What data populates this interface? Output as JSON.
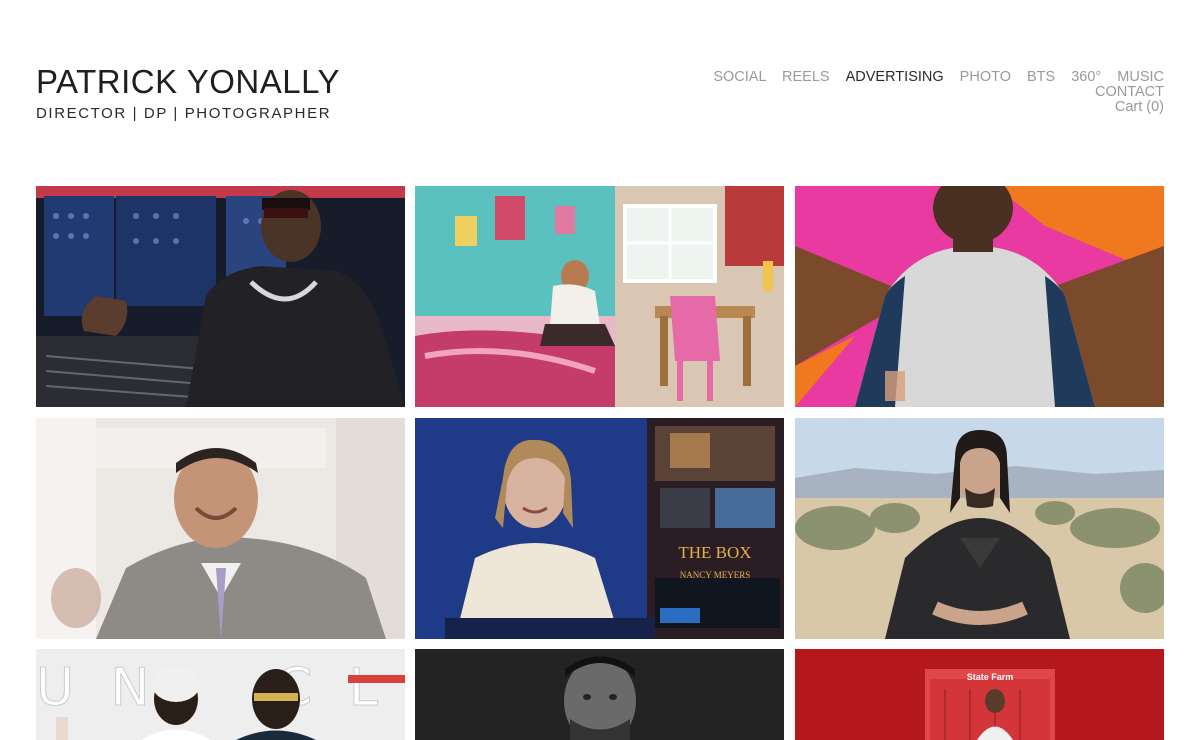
{
  "site": {
    "title": "PATRICK YONALLY",
    "tagline": "DIRECTOR | DP | PHOTOGRAPHER"
  },
  "nav": {
    "items": [
      {
        "label": "SOCIAL",
        "active": false
      },
      {
        "label": "REELS",
        "active": false
      },
      {
        "label": "ADVERTISING",
        "active": true
      },
      {
        "label": "PHOTO",
        "active": false
      },
      {
        "label": "BTS",
        "active": false
      },
      {
        "label": "360°",
        "active": false
      },
      {
        "label": "MUSIC",
        "active": false
      }
    ],
    "contact": "CONTACT",
    "cart": "Cart (0)"
  },
  "tiles": {
    "t5": {
      "title": "THE BOX",
      "credit": "NANCY MEYERS"
    },
    "t7": {
      "letters_left": "U N",
      "letters_right": "C L A"
    },
    "t9": {
      "brand": "State Farm"
    }
  },
  "colors": {
    "active_nav": "#2a2a2a",
    "inactive_nav": "#9a9a9a",
    "title": "#1f1f1f"
  }
}
